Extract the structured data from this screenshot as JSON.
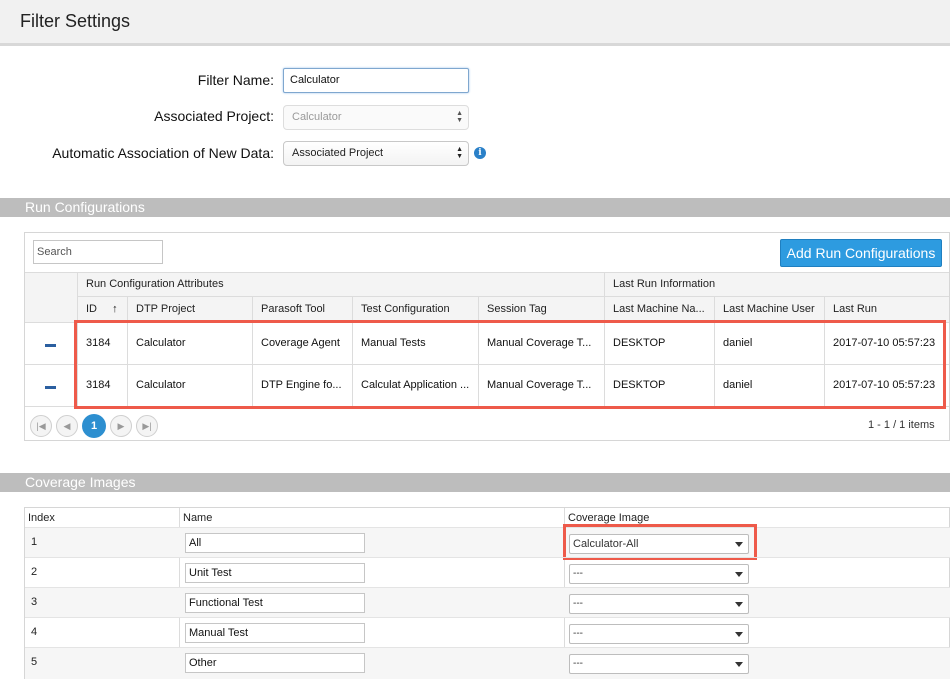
{
  "header": {
    "title": "Filter Settings"
  },
  "form": {
    "filter_name_label": "Filter Name:",
    "filter_name_value": "Calculator",
    "associated_project_label": "Associated Project:",
    "associated_project_value": "Calculator",
    "auto_assoc_label": "Automatic Association of New Data:",
    "auto_assoc_value": "Associated Project",
    "info_icon": "i"
  },
  "run_configurations": {
    "section_title": "Run Configurations",
    "search_placeholder": "Search",
    "add_button": "Add Run Configurations",
    "group_headers": [
      "Run Configuration Attributes",
      "Last Run Information"
    ],
    "columns": [
      "ID",
      "DTP Project",
      "Parasoft Tool",
      "Test Configuration",
      "Session Tag",
      "Last Machine Na...",
      "Last Machine User",
      "Last Run"
    ],
    "sort_indicator": "↑",
    "rows": [
      [
        "3184",
        "Calculator",
        "Coverage Agent",
        "Manual Tests",
        "Manual Coverage T...",
        "DESKTOP",
        "daniel",
        "2017-07-10 05:57:23"
      ],
      [
        "3184",
        "Calculator",
        "DTP Engine fo...",
        "Calculat Application ...",
        "Manual Coverage T...",
        "DESKTOP",
        "daniel",
        "2017-07-10 05:57:23"
      ]
    ],
    "pager": {
      "current_page": "1",
      "info": "1 - 1 / 1 items"
    }
  },
  "coverage_images": {
    "section_title": "Coverage Images",
    "columns": [
      "Index",
      "Name",
      "Coverage Image"
    ],
    "rows": [
      {
        "index": "1",
        "name": "All",
        "image": "Calculator-All"
      },
      {
        "index": "2",
        "name": "Unit Test",
        "image": "---"
      },
      {
        "index": "3",
        "name": "Functional Test",
        "image": "---"
      },
      {
        "index": "4",
        "name": "Manual Test",
        "image": "---"
      },
      {
        "index": "5",
        "name": "Other",
        "image": "---"
      }
    ]
  },
  "colors": {
    "accent": "#2d9be0",
    "highlight": "#ee5a4a",
    "section_bar": "#bdbdbd"
  }
}
